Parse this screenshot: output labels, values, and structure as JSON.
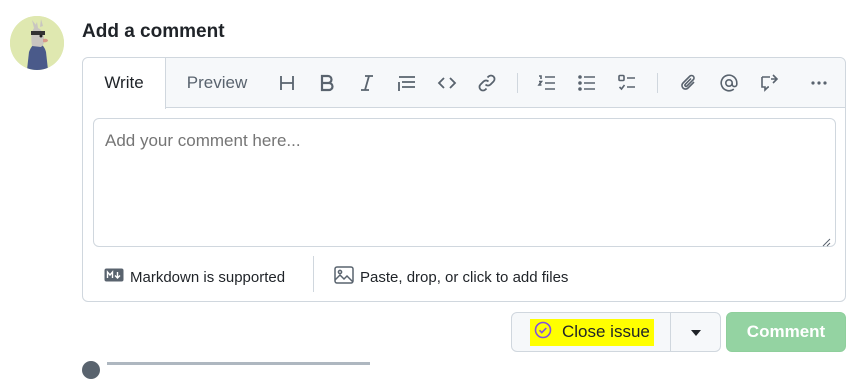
{
  "header": {
    "title": "Add a comment"
  },
  "editor": {
    "tabs": {
      "write": "Write",
      "preview": "Preview"
    },
    "toolbar": [
      "heading-icon",
      "bold-icon",
      "italic-icon",
      "quote-icon",
      "code-icon",
      "link-icon",
      "ordered-list-icon",
      "unordered-list-icon",
      "task-list-icon",
      "attach-icon",
      "mention-icon",
      "reference-icon",
      "more-icon"
    ],
    "placeholder": "Add your comment here...",
    "markdown_label": "Markdown is supported",
    "files_label": "Paste, drop, or click to add files"
  },
  "actions": {
    "close_issue_label": "Close issue",
    "comment_label": "Comment"
  },
  "colors": {
    "accent_green_disabled": "#94d3a2",
    "highlight": "#ffff00",
    "close_icon_purple": "#8250df"
  }
}
